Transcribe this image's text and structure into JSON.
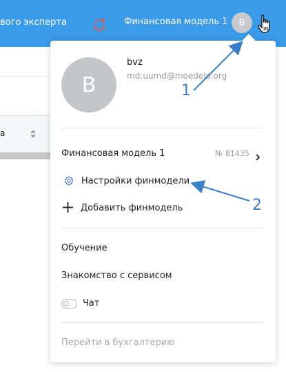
{
  "header": {
    "left_text": "вого эксперта",
    "model_title": "Финансовая модель 1",
    "avatar_letter": "B"
  },
  "background": {
    "column_header": "а"
  },
  "dropdown": {
    "user": {
      "avatar_letter": "B",
      "name": "bvz",
      "email": "md:uumd@moedelo.org"
    },
    "model_item": {
      "label": "Финансовая модель 1",
      "number": "№ 81435"
    },
    "settings_label": "Настройки финмодели",
    "add_label": "Добавить финмодель",
    "training_label": "Обучение",
    "intro_label": "Знакомство с сервисом",
    "chat_label": "Чат",
    "chat_enabled": false,
    "accounting_label": "Перейти в бухгалтерию"
  },
  "annotations": {
    "one": "1",
    "two": "2"
  },
  "colors": {
    "header_bg": "#3a9be9",
    "annotation": "#3a7fc9",
    "bell_icon": "#e05a4e"
  }
}
